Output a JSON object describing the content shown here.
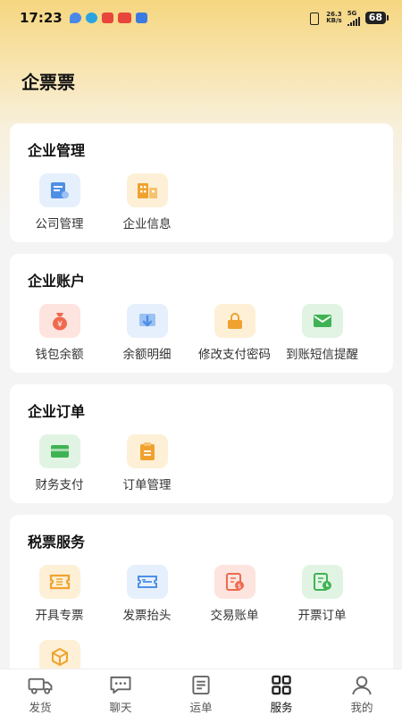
{
  "status_bar": {
    "time": "17:23",
    "speed_value": "26.3",
    "speed_unit": "KB/s",
    "network": "5G",
    "battery": "68"
  },
  "header": {
    "title": "企票票"
  },
  "sections": [
    {
      "title": "企业管理",
      "items": [
        {
          "label": "公司管理",
          "icon": "company-doc-icon",
          "bg": "#e6f0fc",
          "color": "#4e8fe6"
        },
        {
          "label": "企业信息",
          "icon": "building-icon",
          "bg": "#fdf0d6",
          "color": "#f0a22e"
        }
      ]
    },
    {
      "title": "企业账户",
      "items": [
        {
          "label": "钱包余额",
          "icon": "money-bag-icon",
          "bg": "#fde4de",
          "color": "#ee6a4f"
        },
        {
          "label": "余额明细",
          "icon": "download-card-icon",
          "bg": "#e6f0fc",
          "color": "#4e8fe6"
        },
        {
          "label": "修改支付密码",
          "icon": "lock-icon",
          "bg": "#fdf0d6",
          "color": "#f0a22e"
        },
        {
          "label": "到账短信提醒",
          "icon": "mail-icon",
          "bg": "#e1f4e3",
          "color": "#3fb354"
        }
      ]
    },
    {
      "title": "企业订单",
      "items": [
        {
          "label": "财务支付",
          "icon": "card-icon",
          "bg": "#e1f4e3",
          "color": "#3fb354"
        },
        {
          "label": "订单管理",
          "icon": "clipboard-icon",
          "bg": "#fdf0d6",
          "color": "#f0a22e"
        }
      ]
    },
    {
      "title": "税票服务",
      "items": [
        {
          "label": "开具专票",
          "icon": "ticket-icon",
          "bg": "#fdf0d6",
          "color": "#f0a22e"
        },
        {
          "label": "发票抬头",
          "icon": "invoice-header-icon",
          "bg": "#e6f0fc",
          "color": "#4e8fe6"
        },
        {
          "label": "交易账单",
          "icon": "bill-icon",
          "bg": "#fde4de",
          "color": "#ee6a4f"
        },
        {
          "label": "开票订单",
          "icon": "invoice-order-icon",
          "bg": "#e1f4e3",
          "color": "#3fb354"
        },
        {
          "label": "",
          "icon": "box-icon",
          "bg": "#fdf0d6",
          "color": "#f0a22e"
        }
      ]
    }
  ],
  "tabbar": [
    {
      "label": "发货",
      "icon": "truck-icon"
    },
    {
      "label": "聊天",
      "icon": "chat-icon"
    },
    {
      "label": "运单",
      "icon": "waybill-icon"
    },
    {
      "label": "服务",
      "icon": "grid-icon",
      "active": true
    },
    {
      "label": "我的",
      "icon": "user-icon"
    }
  ]
}
